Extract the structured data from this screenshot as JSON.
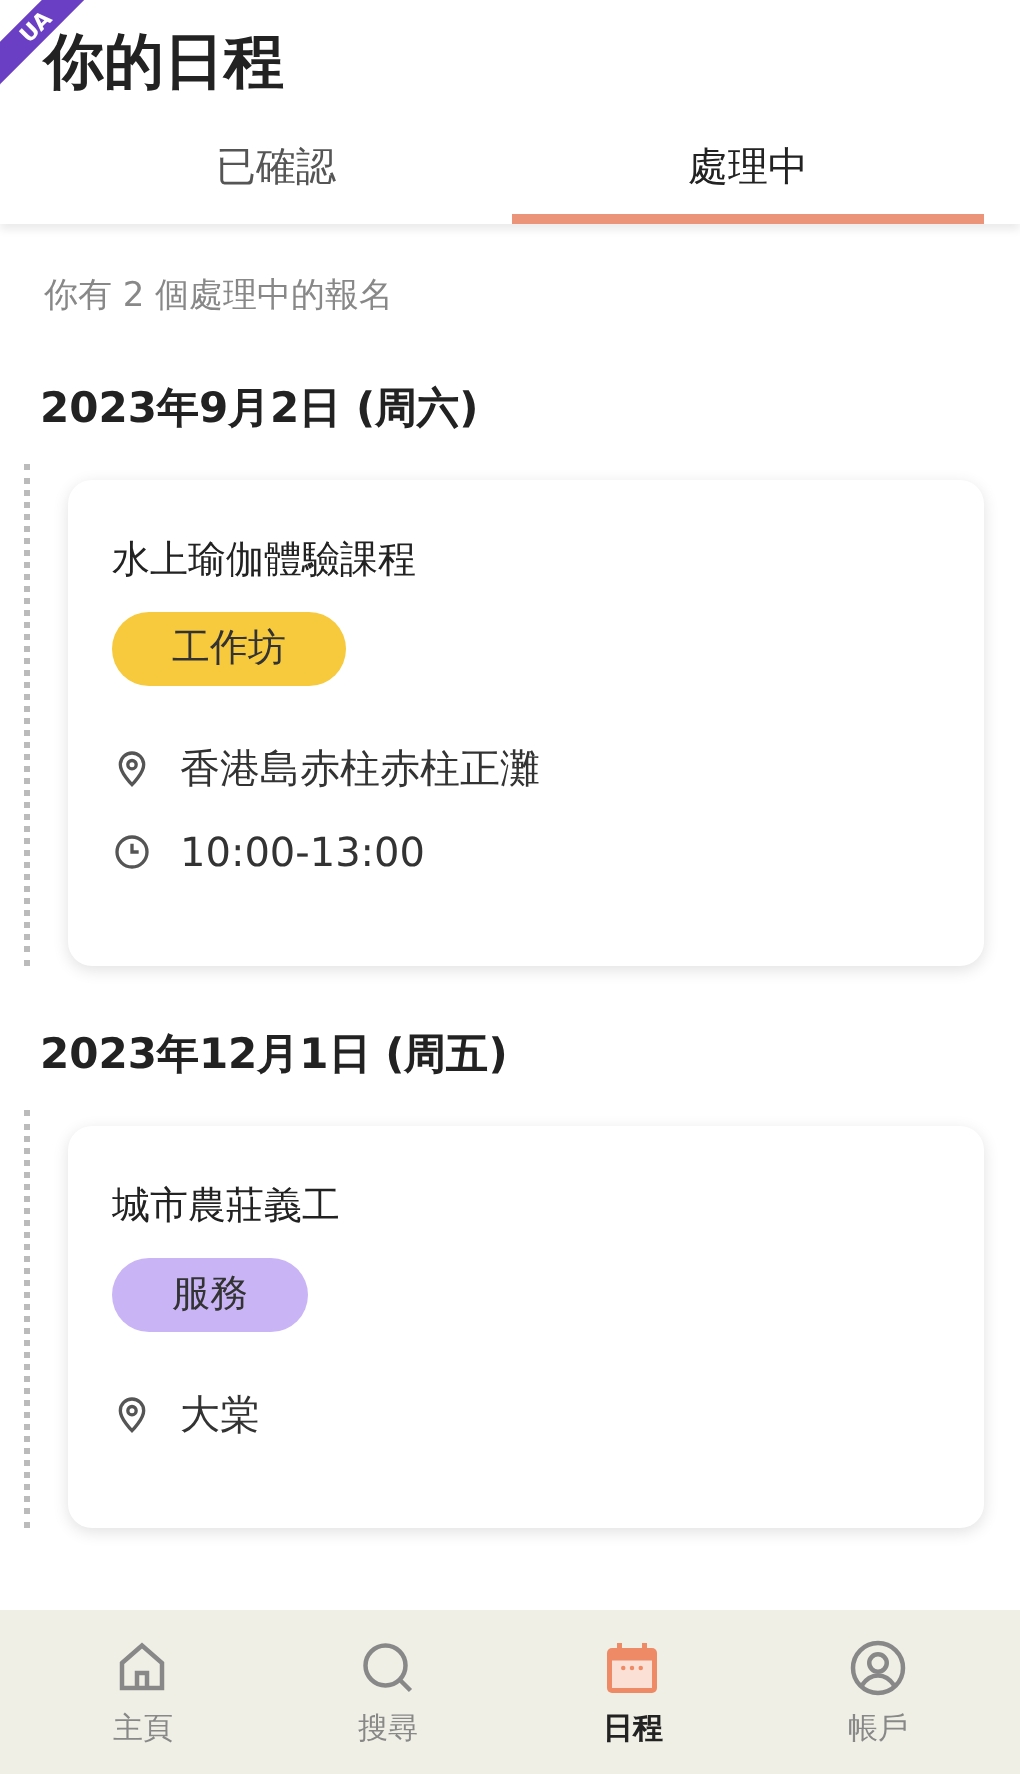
{
  "ribbon": "UA",
  "header": {
    "title": "你的日程"
  },
  "tabs": [
    {
      "label": "已確認",
      "selected": false
    },
    {
      "label": "處理中",
      "selected": true
    }
  ],
  "summary": "你有 2 個處理中的報名",
  "groups": [
    {
      "date": "2023年9月2日 (周六)",
      "events": [
        {
          "title": "水上瑜伽體驗課程",
          "tag": {
            "label": "工作坊",
            "color": "#f7c93c"
          },
          "location": "香港島赤柱赤柱正灘",
          "time": "10:00-13:00"
        }
      ]
    },
    {
      "date": "2023年12月1日 (周五)",
      "events": [
        {
          "title": "城市農莊義工",
          "tag": {
            "label": "服務",
            "color": "#c9b5f6"
          },
          "location": "大棠"
        }
      ]
    }
  ],
  "nav": [
    {
      "kind": "home",
      "label": "主頁",
      "selected": false
    },
    {
      "kind": "search",
      "label": "搜尋",
      "selected": false
    },
    {
      "kind": "calendar",
      "label": "日程",
      "selected": true
    },
    {
      "kind": "account",
      "label": "帳戶",
      "selected": false
    }
  ]
}
